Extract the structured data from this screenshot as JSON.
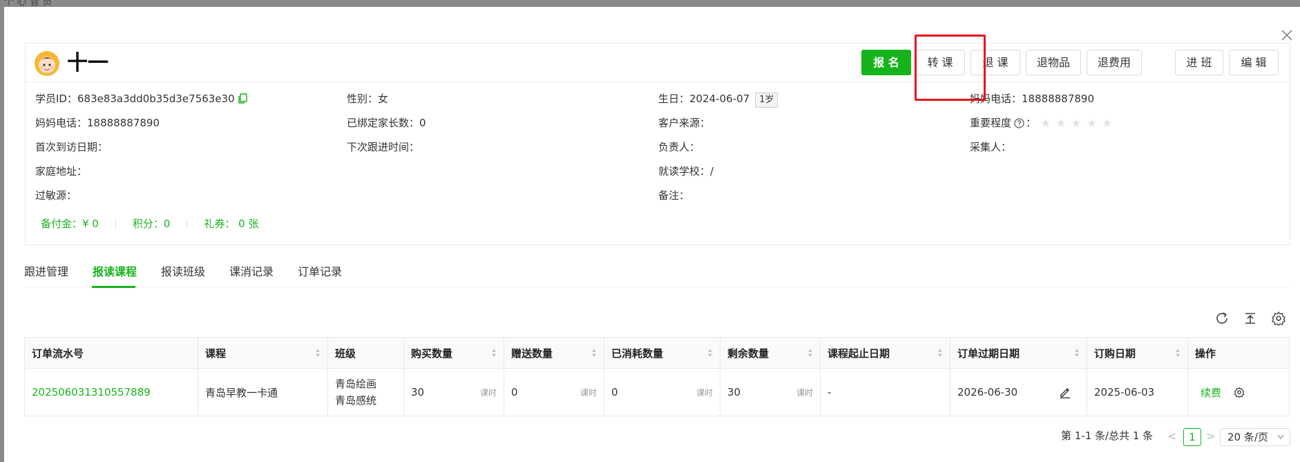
{
  "background": {
    "label": "个 心 管 员"
  },
  "student": {
    "name": "十一",
    "id_label": "学员ID：",
    "id_value": "683e83a3dd0b35d3e7563e30",
    "gender_label": "性别：",
    "gender_value": "女",
    "birthday_label": "生日：",
    "birthday_value": "2024-06-07",
    "age_badge": "1岁",
    "dad_phone_label": "妈妈电话：",
    "dad_phone_value": "18888887890",
    "mom_phone_label": "妈妈电话：",
    "mom_phone_value": "18888887890",
    "bound_parents_label": "已绑定家长数：",
    "bound_parents_value": "0",
    "customer_source_label": "客户来源：",
    "importance_label": "重要程度",
    "first_visit_label": "首次到访日期：",
    "next_follow_label": "下次跟进时间：",
    "owner_label": "负责人：",
    "collector_label": "采集人：",
    "address_label": "家庭地址：",
    "school_label": "就读学校：",
    "school_value": "/",
    "allergy_label": "过敏源：",
    "remark_label": "备注：",
    "stars": "★★★★★",
    "deposit": "备付金：¥ 0",
    "points": "积分：0",
    "coupons": "礼券： 0 张"
  },
  "actions": {
    "enroll": "报 名",
    "transfer": "转 课",
    "refund_course": "退 课",
    "refund_goods": "退物品",
    "refund_fee": "退费用",
    "join_class": "进 班",
    "edit": "编 辑"
  },
  "tabs": [
    "跟进管理",
    "报读课程",
    "报读班级",
    "课消记录",
    "订单记录"
  ],
  "table": {
    "headers": [
      "订单流水号",
      "课程",
      "班级",
      "购买数量",
      "赠送数量",
      "已消耗数量",
      "剩余数量",
      "课程起止日期",
      "订单过期日期",
      "订购日期",
      "操作"
    ],
    "rows": [
      {
        "order_no": "202506031310557889",
        "course": "青岛早教一卡通",
        "class_line1": "青岛绘画",
        "class_line2": "青岛感统",
        "bought": "30",
        "bought_unit": "课时",
        "gift": "0",
        "gift_unit": "课时",
        "consumed": "0",
        "consumed_unit": "课时",
        "remaining": "30",
        "remaining_unit": "课时",
        "date_range": "-",
        "expire_date": "2026-06-30",
        "order_date": "2025-06-03",
        "action": "续费"
      }
    ]
  },
  "pagination": {
    "summary": "第 1-1 条/总共 1 条",
    "prev": "<",
    "current": "1",
    "next": ">",
    "page_size": "20 条/页"
  },
  "colors": {
    "primary": "#17b31d",
    "highlight": "#e8141c"
  }
}
